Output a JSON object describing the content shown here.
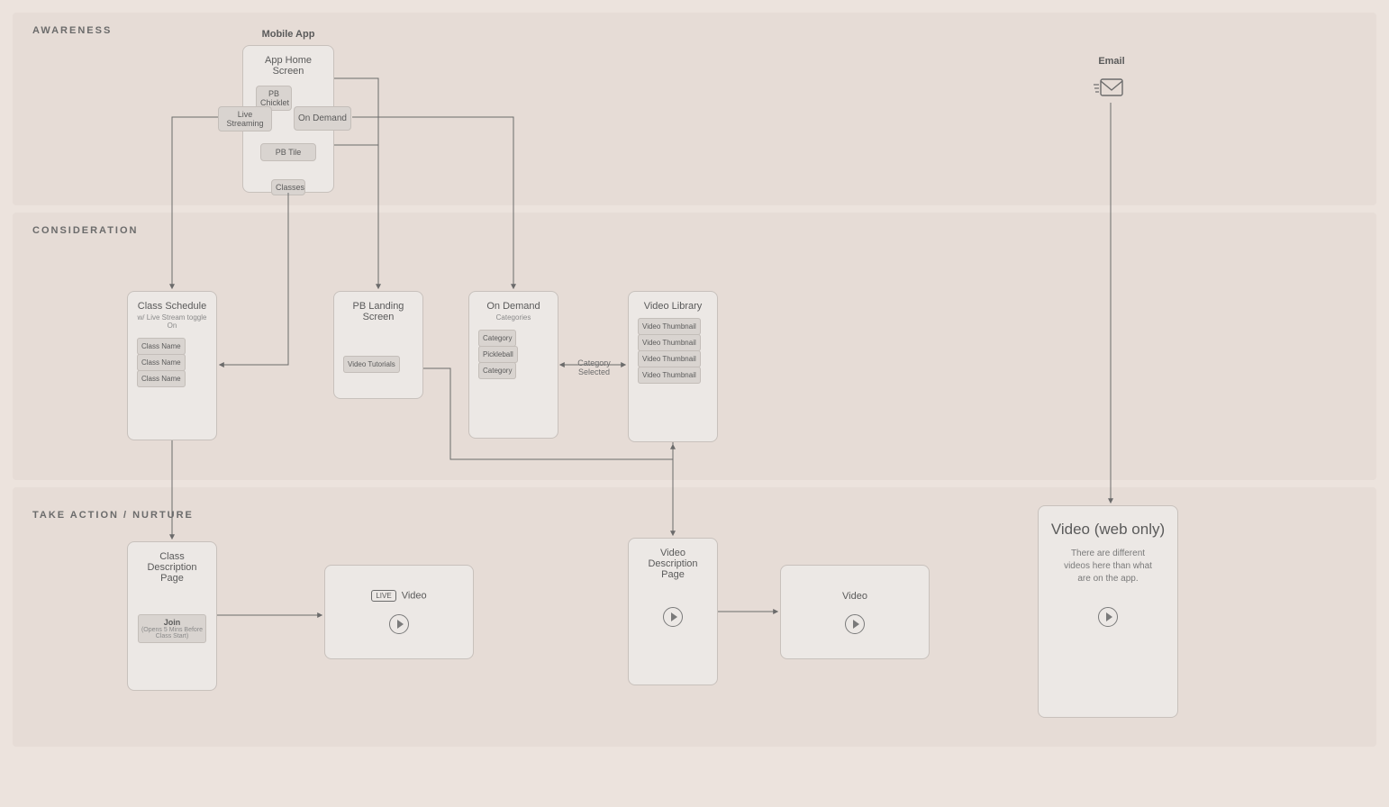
{
  "stages": {
    "awareness": "AWARENESS",
    "consideration": "CONSIDERATION",
    "action": "TAKE ACTION / NURTURE"
  },
  "columns": {
    "mobile": "Mobile App",
    "email": "Email"
  },
  "appHome": {
    "title": "App Home Screen",
    "pbChicklet": "PB Chicklet",
    "pbTile": "PB Tile",
    "classes": "Classes",
    "liveStreaming": "Live\nStreaming",
    "onDemand": "On Demand"
  },
  "classSchedule": {
    "title": "Class Schedule",
    "subtitle": "w/ Live Stream toggle On",
    "rows": [
      "Class Name",
      "Class Name",
      "Class Name"
    ]
  },
  "pbLanding": {
    "title": "PB Landing Screen",
    "tutorials": "Video Tutorials"
  },
  "onDemandScreen": {
    "title": "On Demand",
    "subtitle": "Categories",
    "rows": [
      "Category",
      "Pickleball",
      "Category"
    ]
  },
  "videoLibrary": {
    "title": "Video Library",
    "rows": [
      "Video Thumbnail",
      "Video Thumbnail",
      "Video Thumbnail",
      "Video Thumbnail"
    ]
  },
  "edgeLabels": {
    "categorySelected": "Category Selected"
  },
  "classDescription": {
    "title": "Class Description Page",
    "joinMain": "Join",
    "joinNote": "(Opens 5 Mins Before Class Start)"
  },
  "videoDescription": {
    "title": "Video Description Page"
  },
  "videoBlocks": {
    "liveVideo": "Video",
    "liveBadge": "LIVE",
    "plainVideo": "Video"
  },
  "webVideo": {
    "title": "Video (web only)",
    "subtitle": "There are different videos here than what are on the app."
  }
}
